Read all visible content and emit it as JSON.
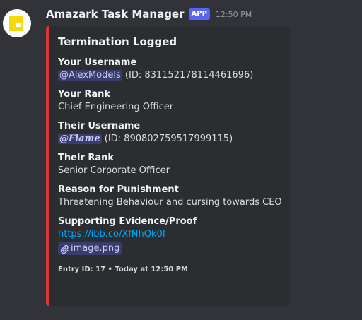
{
  "message": {
    "author": "Amazark Task Manager",
    "badge": "APP",
    "timestamp": "12:50 PM",
    "avatar_icon": "yellow-square-logo-icon"
  },
  "embed": {
    "accent_color": "#da373c",
    "title": "Termination Logged",
    "fields": {
      "your_username": {
        "name": "Your Username",
        "mention": "@AlexModels",
        "suffix": "(ID: 831152178114461696)"
      },
      "your_rank": {
        "name": "Your Rank",
        "value": "Chief Engineering Officer"
      },
      "their_username": {
        "name": "Their Username",
        "mention": "@Flame",
        "suffix": "(ID: 890802759517999115)"
      },
      "their_rank": {
        "name": "Their Rank",
        "value": "Senior Corporate Officer"
      },
      "reason": {
        "name": "Reason for Punishment",
        "value": "Threatening Behaviour and cursing towards CEO"
      },
      "evidence": {
        "name": "Supporting Evidence/Proof",
        "link": "https://ibb.co/XfNhQk0f",
        "attachment": "image.png",
        "attachment_icon": "paperclip-icon"
      }
    },
    "footer": "Entry ID: 17 • Today at 12:50 PM"
  }
}
